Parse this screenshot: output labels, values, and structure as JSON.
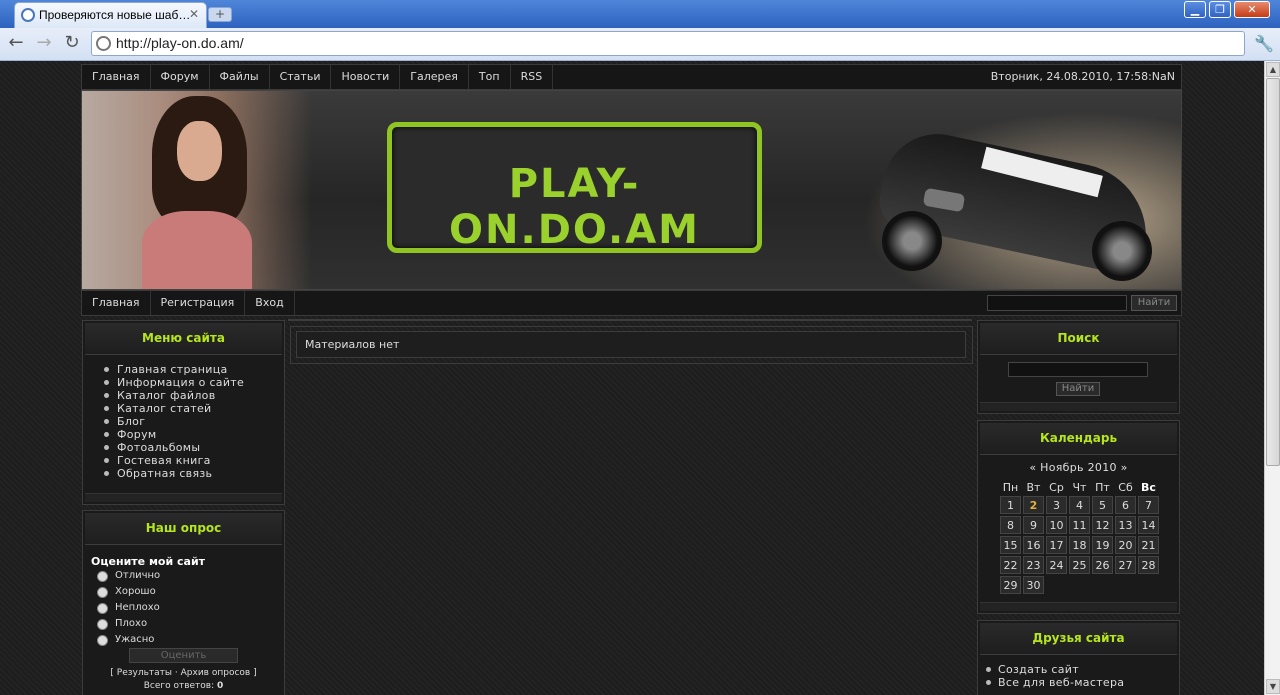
{
  "browser": {
    "tab_title": "Проверяются новые шаб…",
    "url": "http://play-on.do.am/"
  },
  "top_nav": [
    "Главная",
    "Форум",
    "Файлы",
    "Статьи",
    "Новости",
    "Галерея",
    "Топ",
    "RSS"
  ],
  "datetime": "Вторник, 24.08.2010, 17:58:NaN",
  "banner": {
    "logo_text": "PLAY-ON.DO.AM"
  },
  "sub_nav": [
    "Главная",
    "Регистрация",
    "Вход"
  ],
  "header_search_button": "Найти",
  "left": {
    "menu": {
      "title": "Меню сайта",
      "items": [
        "Главная страница",
        "Информация о сайте",
        "Каталог файлов",
        "Каталог статей",
        "Блог",
        "Форум",
        "Фотоальбомы",
        "Гостевая книга",
        "Обратная связь"
      ]
    },
    "poll": {
      "title": "Наш опрос",
      "question": "Оцените мой сайт",
      "options": [
        "Отлично",
        "Хорошо",
        "Неплохо",
        "Плохо",
        "Ужасно"
      ],
      "button": "Оценить",
      "results_link": "Результаты",
      "archive_link": "Архив опросов",
      "total_label": "Всего ответов:",
      "total_value": "0"
    }
  },
  "main": {
    "empty_text": "Материалов нет"
  },
  "right": {
    "search": {
      "title": "Поиск",
      "button": "Найти"
    },
    "calendar": {
      "title": "Календарь",
      "prev": "«",
      "month": "Ноябрь 2010",
      "next": "»",
      "weekdays": [
        "Пн",
        "Вт",
        "Ср",
        "Чт",
        "Пт",
        "Сб",
        "Вс"
      ],
      "weeks": [
        [
          "1",
          "2",
          "3",
          "4",
          "5",
          "6",
          "7"
        ],
        [
          "8",
          "9",
          "10",
          "11",
          "12",
          "13",
          "14"
        ],
        [
          "15",
          "16",
          "17",
          "18",
          "19",
          "20",
          "21"
        ],
        [
          "22",
          "23",
          "24",
          "25",
          "26",
          "27",
          "28"
        ],
        [
          "29",
          "30",
          "",
          "",
          "",
          "",
          ""
        ]
      ],
      "highlight": "2"
    },
    "friends": {
      "title": "Друзья сайта",
      "items": [
        "Создать сайт",
        "Все для веб-мастера"
      ]
    }
  },
  "colors": {
    "accent_green": "#b5e61d",
    "logo_green": "#9ad12c",
    "today": "#e0b43a"
  }
}
